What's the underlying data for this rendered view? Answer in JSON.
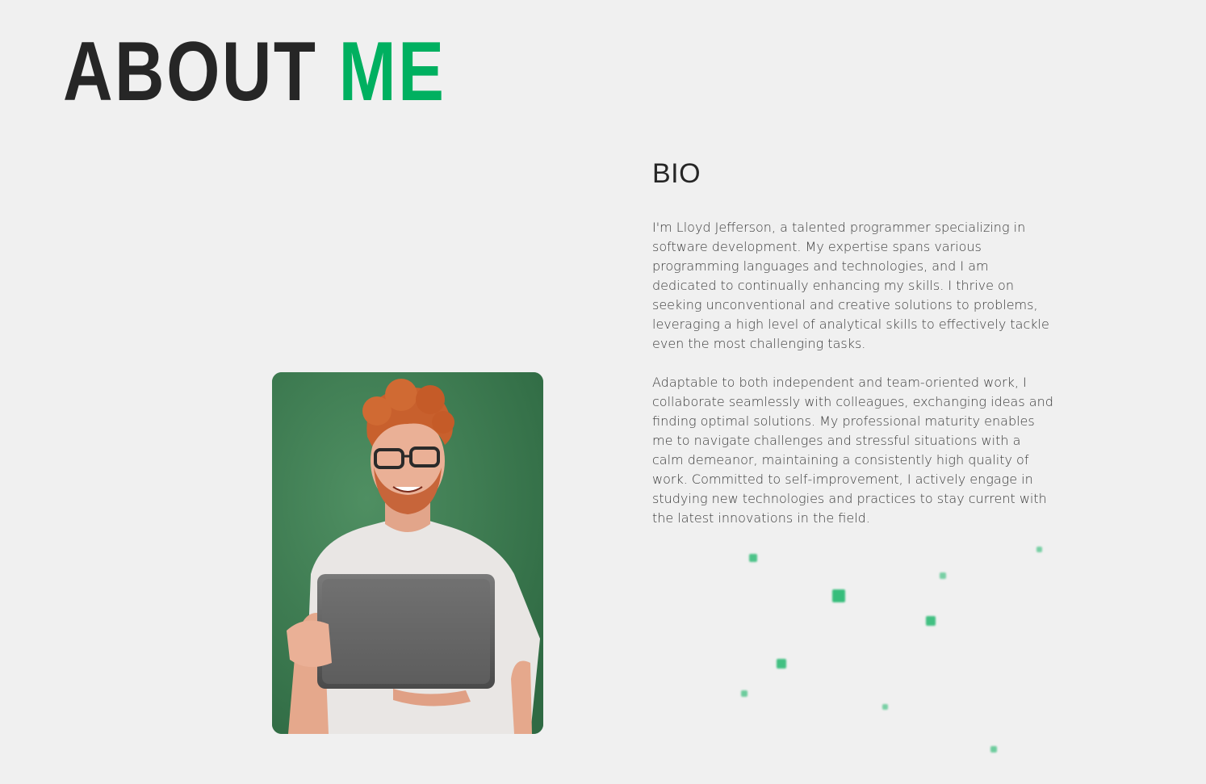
{
  "heading": {
    "word1": "ABOUT",
    "word2": "ME",
    "accent_color": "#00b060"
  },
  "photo": {
    "description_icon": "portrait-photo"
  },
  "bio": {
    "title": "BIO",
    "paragraph1": "I'm Lloyd Jefferson, a talented programmer specializing in software development. My expertise spans various programming languages and technologies, and I am dedicated to continually enhancing my skills. I thrive on seeking unconventional and creative solutions to problems, leveraging a high level of analytical skills to effectively tackle even the most challenging tasks.",
    "paragraph2": "Adaptable to both independent and team-oriented work, I collaborate seamlessly with colleagues, exchanging ideas and finding optimal solutions. My professional maturity enables me to navigate challenges and stressful situations with a calm demeanor, maintaining a consistently high quality of work. Committed to self-improvement, I actively engage in studying new technologies and practices to stay current with the latest innovations in the field."
  },
  "colors": {
    "background": "#f0f0f0",
    "text": "#262626",
    "accent": "#00b060"
  }
}
